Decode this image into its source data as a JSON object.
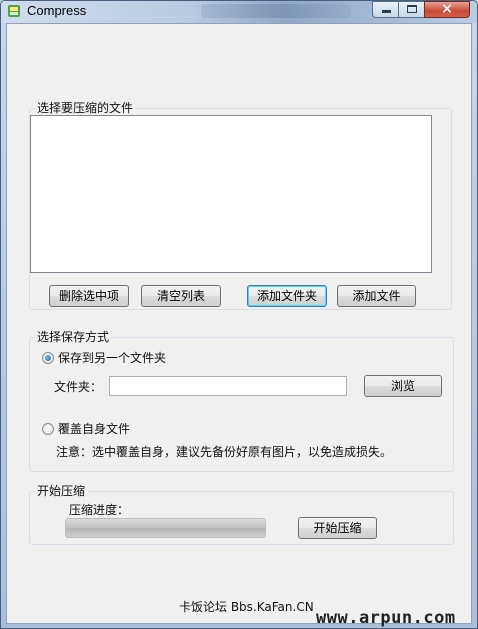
{
  "window": {
    "title": "Compress"
  },
  "titlebar": {
    "icon": "compress-app-icon",
    "close_glyph": "×"
  },
  "files_group": {
    "legend": "选择要压缩的文件",
    "buttons": {
      "remove_selected": "删除选中项",
      "clear_list": "清空列表",
      "add_folder": "添加文件夹",
      "add_file": "添加文件"
    }
  },
  "save_group": {
    "legend": "选择保存方式",
    "option_folder": {
      "label": "保存到另一个文件夹",
      "checked": true
    },
    "folder_label": "文件夹：",
    "folder_value": "",
    "browse_button": "浏览",
    "option_overwrite": {
      "label": "覆盖自身文件",
      "checked": false
    },
    "note": "注意：选中覆盖自身，建议先备份好原有图片，以免造成损失。"
  },
  "compress_group": {
    "legend": "开始压缩",
    "progress_label": "压缩进度：",
    "progress_percent": 0,
    "start_button": "开始压缩"
  },
  "footer": {
    "credit": "卡饭论坛 Bbs.KaFan.CN"
  },
  "watermark": "www.arpun.com",
  "colors": {
    "accent": "#3c7fb1",
    "close_button": "#c74a33"
  }
}
